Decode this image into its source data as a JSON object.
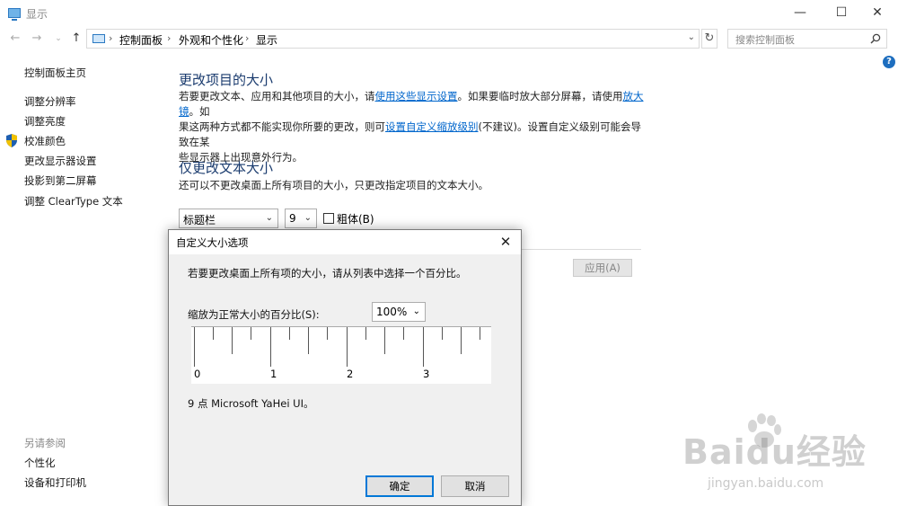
{
  "window": {
    "title": "显示",
    "minimize": "—",
    "maximize": "☐",
    "close": "✕"
  },
  "nav": {
    "breadcrumb": [
      "控制面板",
      "外观和个性化",
      "显示"
    ],
    "separator": "›",
    "search_placeholder": "搜索控制面板"
  },
  "sidebar": {
    "home": "控制面板主页",
    "items": [
      "调整分辨率",
      "调整亮度",
      "校准颜色",
      "更改显示器设置",
      "投影到第二屏幕",
      "调整 ClearType 文本"
    ],
    "see_also_title": "另请参阅",
    "see_also": [
      "个性化",
      "设备和打印机"
    ]
  },
  "main": {
    "section1_title": "更改项目的大小",
    "p1_a": "若要更改文本、应用和其他项目的大小，请",
    "p1_link1": "使用这些显示设置",
    "p1_b": "。如果要临时放大部分屏幕，请使用",
    "p1_link2": "放大镜",
    "p1_c": "。如",
    "p1_d": "果这两种方式都不能实现你所要的更改，则可",
    "p1_link3": "设置自定义缩放级别",
    "p1_e": "(不建议)。设置自定义级别可能会导致在某",
    "p1_f": "些显示器上出现意外行为。",
    "section2_title": "仅更改文本大小",
    "p2": "还可以不更改桌面上所有项目的大小，只更改指定项目的文本大小。",
    "item_select": "标题栏",
    "size_select": "9",
    "bold_label": "粗体(B)",
    "apply_button": "应用(A)"
  },
  "dialog": {
    "title": "自定义大小选项",
    "instruction": "若要更改桌面上所有项的大小，请从列表中选择一个百分比。",
    "scale_label": "缩放为正常大小的百分比(S):",
    "scale_value": "100%",
    "ruler_numbers": [
      "0",
      "1",
      "2",
      "3"
    ],
    "font_info": "9 点 Microsoft YaHei UI。",
    "ok_button": "确定",
    "cancel_button": "取消"
  },
  "watermark": {
    "main": "Baidu经验",
    "sub": "jingyan.baidu.com"
  }
}
